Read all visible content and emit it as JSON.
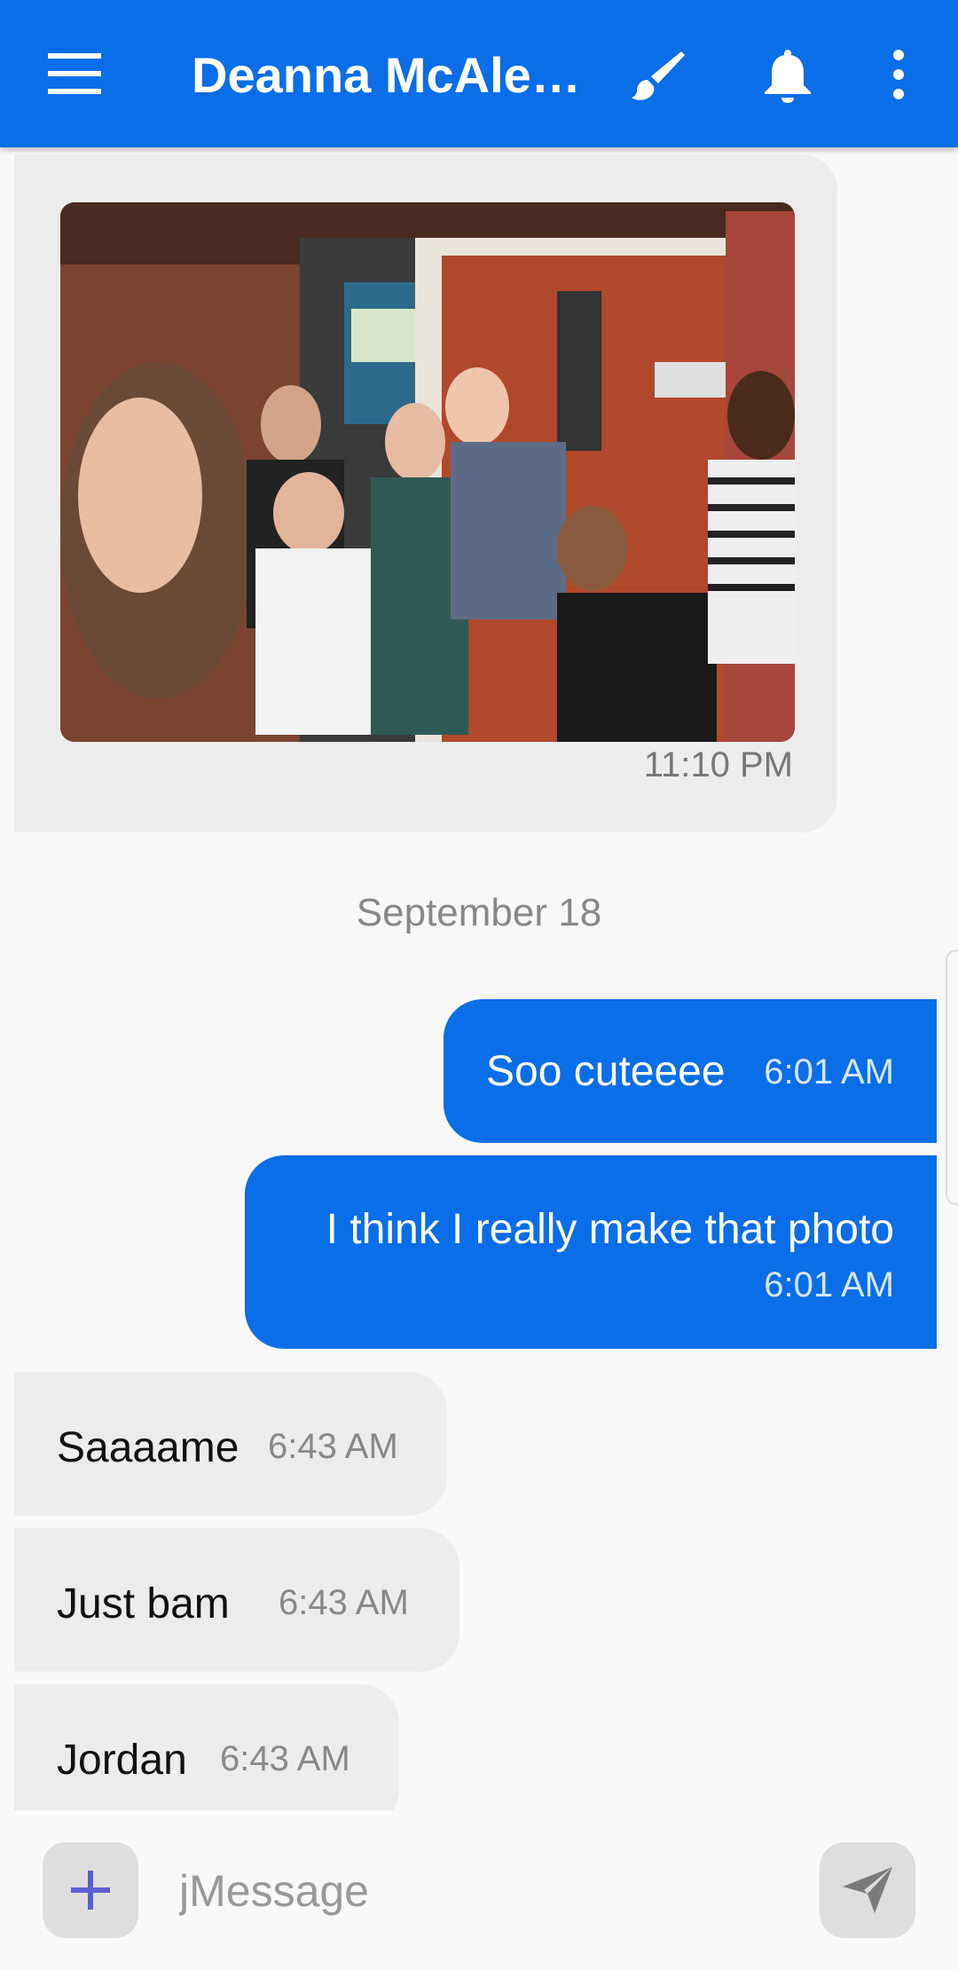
{
  "header": {
    "title": "Deanna McAle…",
    "icons": [
      "menu-icon",
      "brush-icon",
      "bell-icon",
      "more-vert-icon"
    ],
    "color": "#0a6ee9"
  },
  "conversation": {
    "photo_message": {
      "time": "11:10 PM"
    },
    "date_separator": "September 18",
    "outgoing": [
      {
        "text": "Soo cuteeee",
        "time": "6:01 AM"
      },
      {
        "text": "I think I really make that photo",
        "time": "6:01 AM"
      }
    ],
    "incoming": [
      {
        "text": "Saaaame",
        "time": "6:43 AM"
      },
      {
        "text": "Just bam",
        "time": "6:43 AM"
      },
      {
        "text": "Jordan",
        "time": "6:43 AM"
      }
    ]
  },
  "composer": {
    "placeholder": "jMessage",
    "add_icon": "plus-icon",
    "send_icon": "send-icon"
  }
}
